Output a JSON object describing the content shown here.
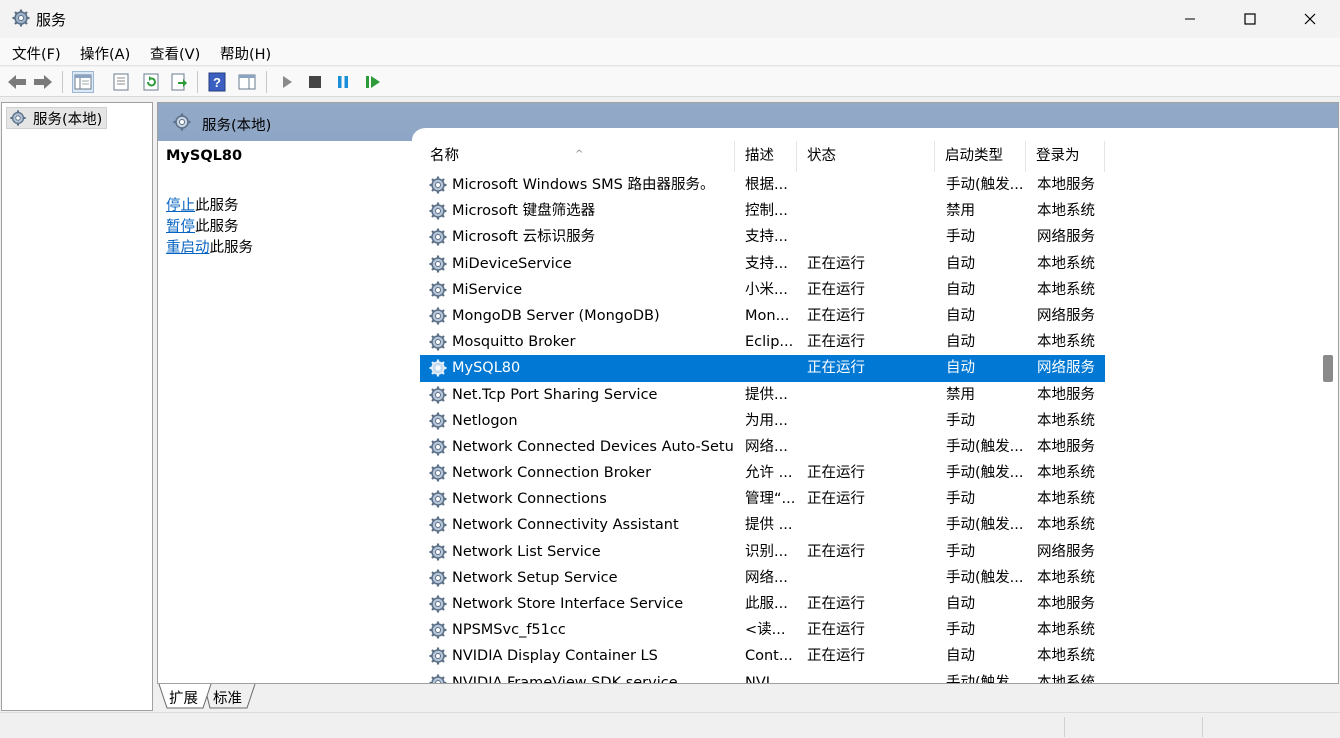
{
  "window": {
    "title": "服务"
  },
  "menu": [
    "文件(F)",
    "操作(A)",
    "查看(V)",
    "帮助(H)"
  ],
  "toolbar_icons": [
    "back-icon",
    "forward-icon",
    "show-tree-icon",
    "properties-icon",
    "refresh-icon",
    "export-list-icon",
    "help-icon",
    "show-action-pane-icon",
    "start-service-icon",
    "stop-service-icon",
    "pause-service-icon",
    "restart-service-icon"
  ],
  "tree": {
    "root_label": "服务(本地)"
  },
  "pane": {
    "header_title": "服务(本地)",
    "selected_service": "MySQL80",
    "actions": [
      {
        "link": "停止",
        "rest": "此服务"
      },
      {
        "link": "暂停",
        "rest": "此服务"
      },
      {
        "link": "重启动",
        "rest": "此服务"
      }
    ]
  },
  "columns": [
    "名称",
    "描述",
    "状态",
    "启动类型",
    "登录为"
  ],
  "rows": [
    {
      "name": "Microsoft Windows SMS 路由器服务。",
      "desc": "根据...",
      "status": "",
      "startup": "手动(触发...",
      "logon": "本地服务"
    },
    {
      "name": "Microsoft 键盘筛选器",
      "desc": "控制...",
      "status": "",
      "startup": "禁用",
      "logon": "本地系统"
    },
    {
      "name": "Microsoft 云标识服务",
      "desc": "支持...",
      "status": "",
      "startup": "手动",
      "logon": "网络服务"
    },
    {
      "name": "MiDeviceService",
      "desc": "支持...",
      "status": "正在运行",
      "startup": "自动",
      "logon": "本地系统"
    },
    {
      "name": "MiService",
      "desc": "小米...",
      "status": "正在运行",
      "startup": "自动",
      "logon": "本地系统"
    },
    {
      "name": "MongoDB Server (MongoDB)",
      "desc": "Mon...",
      "status": "正在运行",
      "startup": "自动",
      "logon": "网络服务"
    },
    {
      "name": "Mosquitto Broker",
      "desc": "Eclip...",
      "status": "正在运行",
      "startup": "自动",
      "logon": "本地系统"
    },
    {
      "name": "MySQL80",
      "desc": "",
      "status": "正在运行",
      "startup": "自动",
      "logon": "网络服务",
      "selected": true
    },
    {
      "name": "Net.Tcp Port Sharing Service",
      "desc": "提供...",
      "status": "",
      "startup": "禁用",
      "logon": "本地服务"
    },
    {
      "name": "Netlogon",
      "desc": "为用...",
      "status": "",
      "startup": "手动",
      "logon": "本地系统"
    },
    {
      "name": "Network Connected Devices Auto-Setup",
      "desc": "网络...",
      "status": "",
      "startup": "手动(触发...",
      "logon": "本地服务"
    },
    {
      "name": "Network Connection Broker",
      "desc": "允许 ...",
      "status": "正在运行",
      "startup": "手动(触发...",
      "logon": "本地系统"
    },
    {
      "name": "Network Connections",
      "desc": "管理“...",
      "status": "正在运行",
      "startup": "手动",
      "logon": "本地系统"
    },
    {
      "name": "Network Connectivity Assistant",
      "desc": "提供 ...",
      "status": "",
      "startup": "手动(触发...",
      "logon": "本地系统"
    },
    {
      "name": "Network List Service",
      "desc": "识别...",
      "status": "正在运行",
      "startup": "手动",
      "logon": "网络服务"
    },
    {
      "name": "Network Setup Service",
      "desc": "网络...",
      "status": "",
      "startup": "手动(触发...",
      "logon": "本地系统"
    },
    {
      "name": "Network Store Interface Service",
      "desc": "此服...",
      "status": "正在运行",
      "startup": "自动",
      "logon": "本地服务"
    },
    {
      "name": "NPSMSvc_f51cc",
      "desc": "<读...",
      "status": "正在运行",
      "startup": "手动",
      "logon": "本地系统"
    },
    {
      "name": "NVIDIA Display Container LS",
      "desc": "Cont...",
      "status": "正在运行",
      "startup": "自动",
      "logon": "本地系统"
    },
    {
      "name": "NVIDIA FrameView SDK service",
      "desc": "NVI...",
      "status": "",
      "startup": "手动(触发...",
      "logon": "本地系统"
    }
  ],
  "tabs": [
    "扩展",
    "标准"
  ],
  "colors": {
    "selection": "#0078d4",
    "header_band": "#8ea6c6",
    "link": "#0563c1"
  }
}
